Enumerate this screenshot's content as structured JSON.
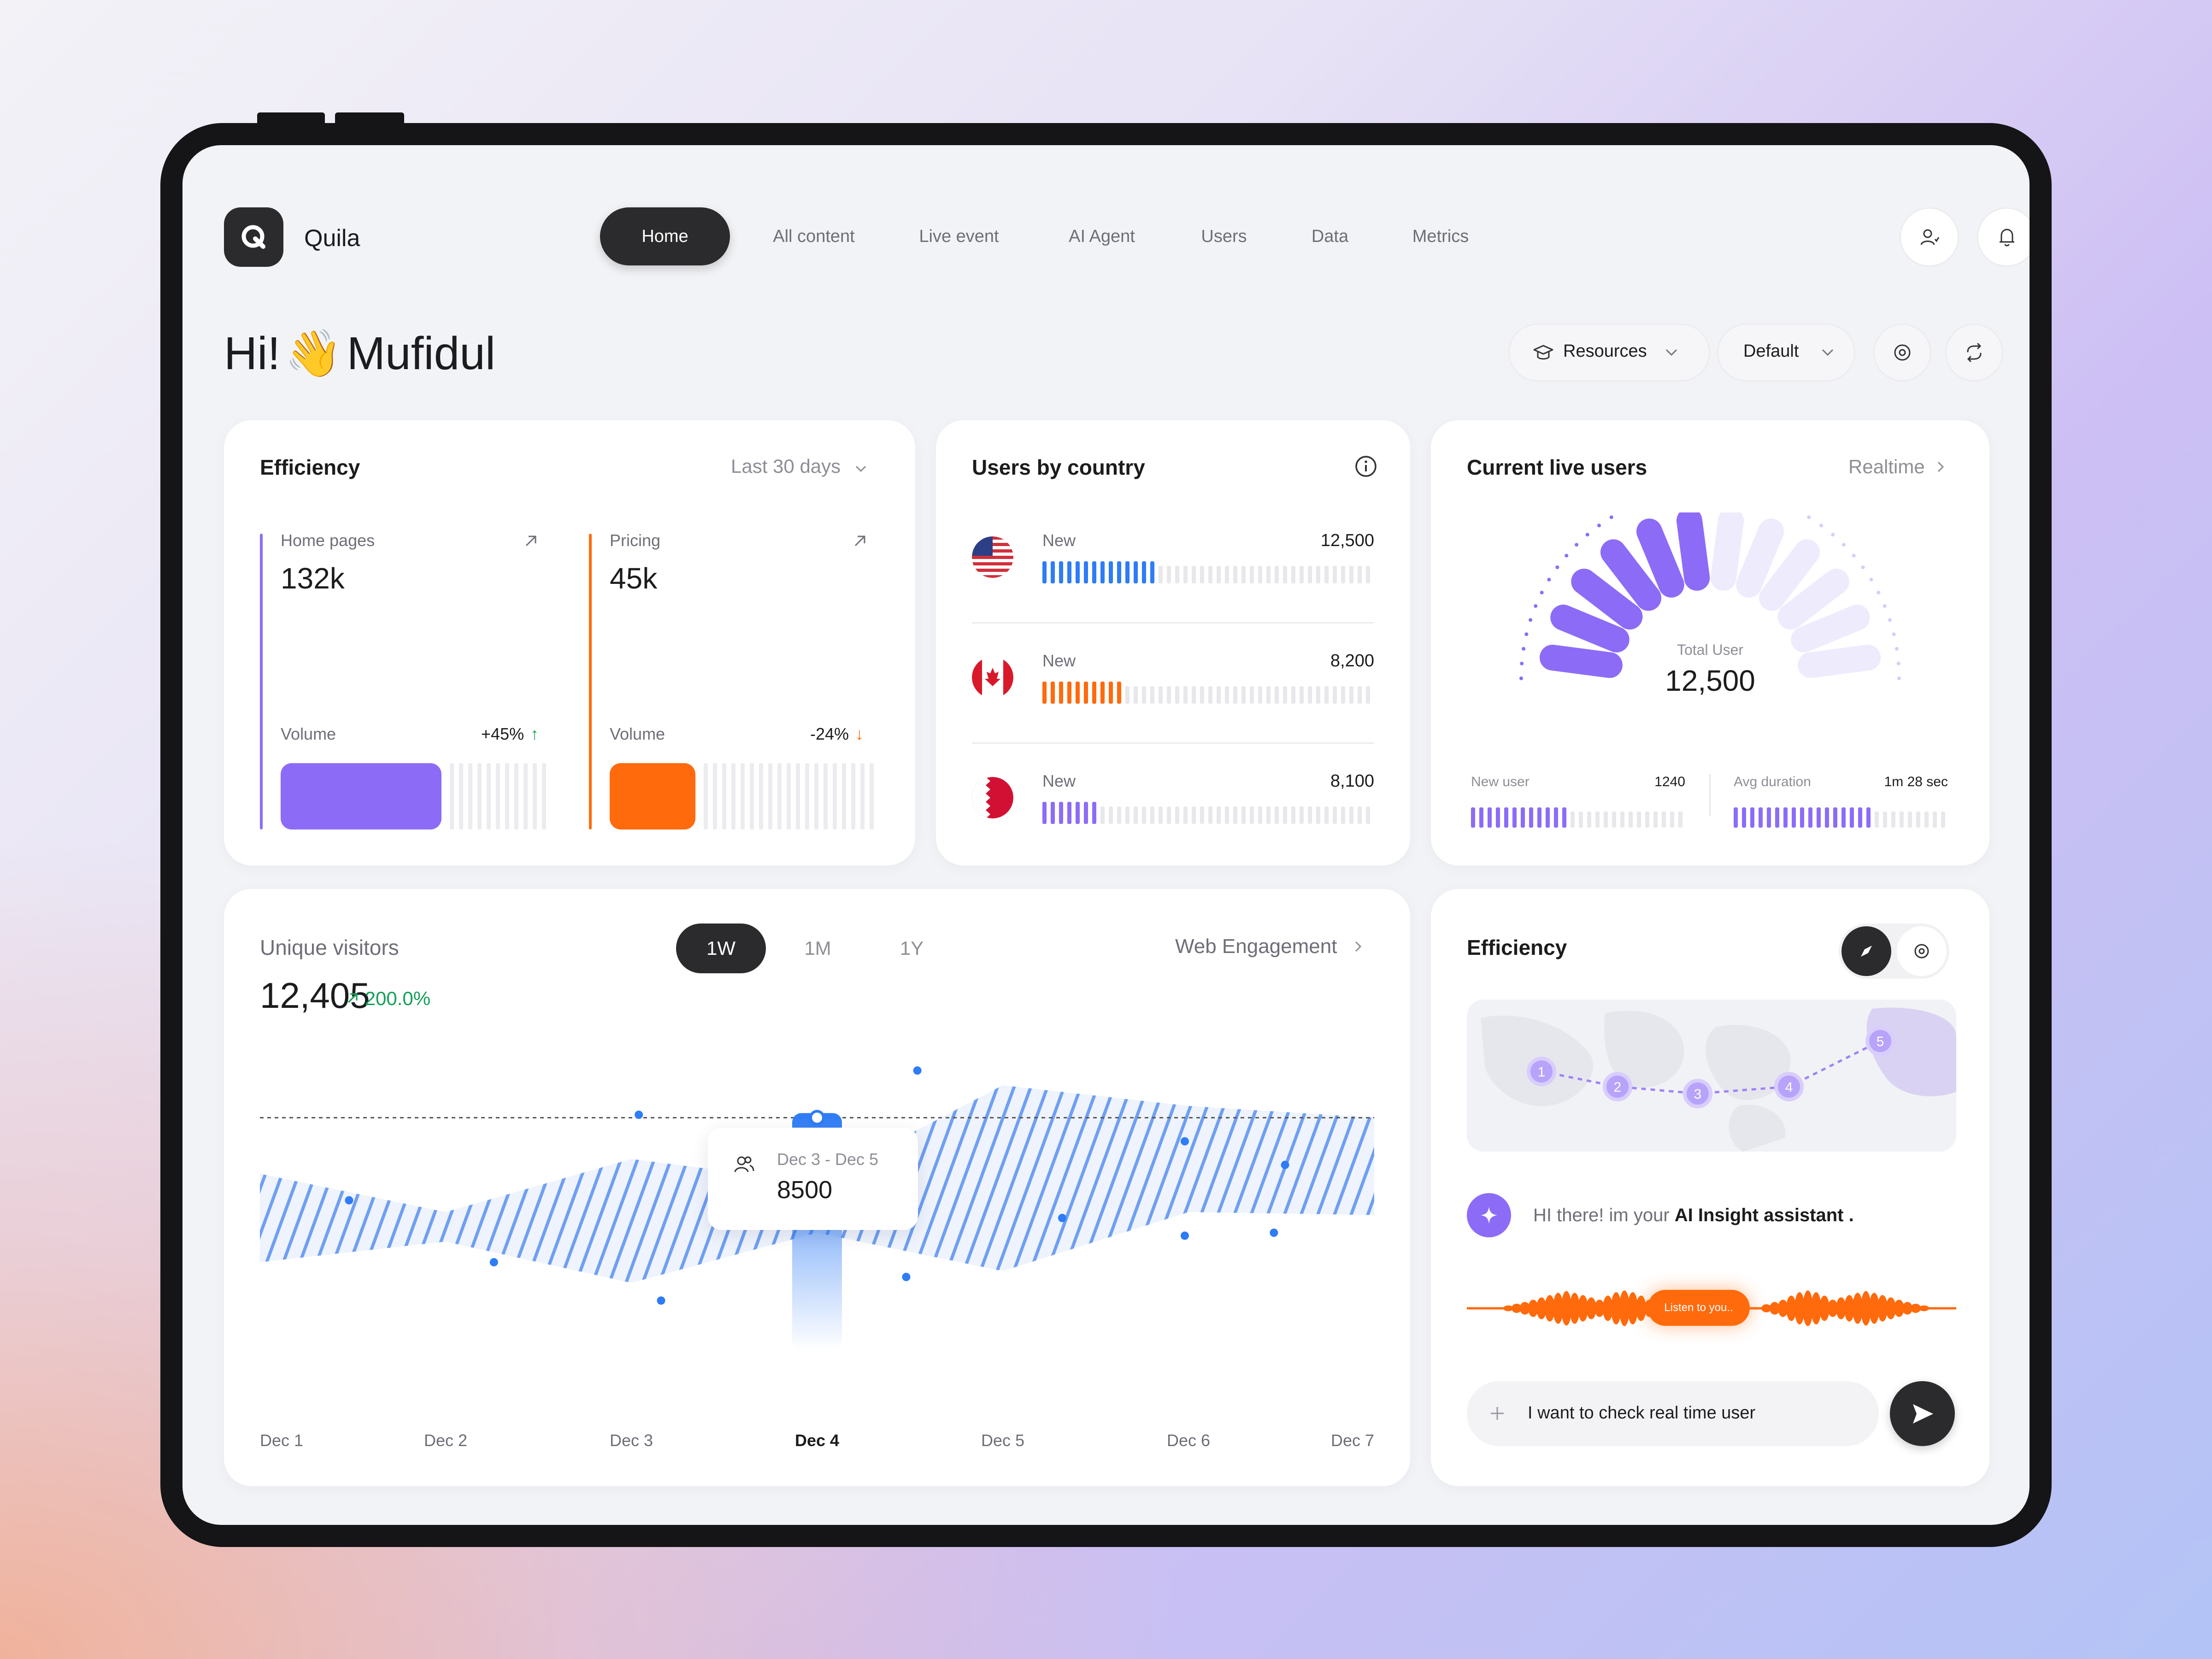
{
  "app": {
    "name": "Quila"
  },
  "nav": {
    "items": [
      "Home",
      "All content",
      "Live event",
      "AI Agent",
      "Users",
      "Data",
      "Metrics"
    ],
    "active": "Home"
  },
  "greeting": {
    "hi": "Hi!",
    "wave": "👋",
    "name": "Mufidul"
  },
  "controls": {
    "resources_label": "Resources",
    "default_label": "Default"
  },
  "efficiency_card": {
    "title": "Efficiency",
    "period": "Last 30 days",
    "metrics": [
      {
        "label": "Home pages",
        "value": "132k",
        "volume_label": "Volume",
        "change": "+45%",
        "direction": "up",
        "fill": 0.6,
        "color": "#8c6cf7"
      },
      {
        "label": "Pricing",
        "value": "45k",
        "volume_label": "Volume",
        "change": "-24%",
        "direction": "down",
        "fill": 0.32,
        "color": "#ff6a0c"
      }
    ]
  },
  "users_by_country": {
    "title": "Users by country",
    "rows": [
      {
        "country": "United States",
        "flag": "us-flag",
        "label": "New",
        "value": "12,500",
        "fill": 0.35,
        "color": "#2e7cf6"
      },
      {
        "country": "Canada",
        "flag": "canada-flag",
        "label": "New",
        "value": "8,200",
        "fill": 0.25,
        "color": "#ff6a0c"
      },
      {
        "country": "Bahrain",
        "flag": "bahrain-flag",
        "label": "New",
        "value": "8,100",
        "fill": 0.18,
        "color": "#8c6cf7"
      }
    ]
  },
  "live_users": {
    "title": "Current live users",
    "link": "Realtime",
    "total_label": "Total User",
    "total_value": "12,500",
    "gauge_fill": 0.5,
    "stats": [
      {
        "label": "New user",
        "value": "1240",
        "fill": 0.45
      },
      {
        "label": "Avg duration",
        "value": "1m 28 sec",
        "fill": 0.65
      }
    ]
  },
  "visitors": {
    "title": "Unique visitors",
    "value": "12,405",
    "change": "200.0%",
    "ranges": [
      "1W",
      "1M",
      "1Y"
    ],
    "active_range": "1W",
    "link": "Web Engagement",
    "tooltip": {
      "range": "Dec 3 - Dec 5",
      "value": "8500"
    }
  },
  "chart_data": {
    "type": "area",
    "title": "Unique visitors",
    "categories": [
      "Dec 1",
      "Dec 2",
      "Dec 3",
      "Dec 4",
      "Dec 5",
      "Dec 6",
      "Dec 7"
    ],
    "highlight": "Dec 4",
    "series": [
      {
        "values": [
          0.55,
          0.42,
          0.6,
          0.52,
          0.85,
          0.78,
          0.74
        ]
      },
      {
        "values": [
          0.25,
          0.32,
          0.18,
          0.35,
          0.22,
          0.42,
          0.41
        ]
      }
    ],
    "reference_line": 0.74
  },
  "ai_card": {
    "title": "Efficiency",
    "route_stops": [
      "1",
      "2",
      "3",
      "4",
      "5"
    ],
    "greeting_prefix": "HI there! im your ",
    "greeting_bold": "AI Insight assistant .",
    "listen_label": "Listen to you..",
    "input_value": "I want to check real time user"
  },
  "colors": {
    "purple": "#8c6cf7",
    "orange": "#ff6a0c",
    "blue": "#2e7cf6",
    "dark": "#2b2b2d"
  }
}
